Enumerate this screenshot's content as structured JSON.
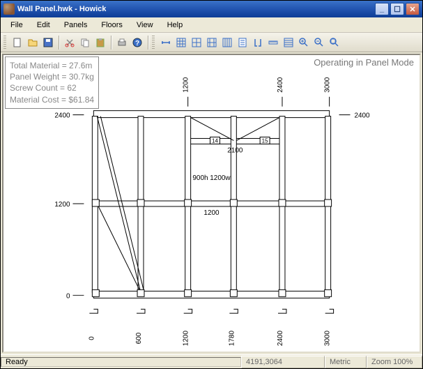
{
  "titlebar": {
    "filename": "Wall Panel.hwk",
    "appname": "Howick"
  },
  "menus": [
    "File",
    "Edit",
    "Panels",
    "Floors",
    "View",
    "Help"
  ],
  "info_box": {
    "material": "Total Material = 27.6m",
    "weight": "Panel Weight = 30.7kg",
    "screws": "Screw Count = 62",
    "cost": "Material Cost = $61.84"
  },
  "mode": "Operating in Panel Mode",
  "statusbar": {
    "ready": "Ready",
    "coords": "4191,3064",
    "units": "Metric",
    "zoom": "Zoom 100%"
  },
  "drawing_dims": {
    "top_left": "1200",
    "top_right": "2400",
    "far_right_top": "3000",
    "left_mid": "2400",
    "left_low": "1200",
    "left_bot": "0",
    "right_mid": "2400",
    "inner_width": "2100",
    "center_label": "900h 1200w",
    "center_row": "1200",
    "bot_row": [
      "0",
      "600",
      "1200",
      "1780",
      "2400",
      "3000"
    ],
    "node_a": "14",
    "node_b": "15"
  }
}
